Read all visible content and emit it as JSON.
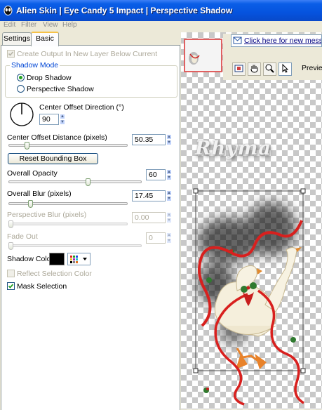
{
  "window": {
    "title": "Alien Skin | Eye Candy 5 Impact | Perspective Shadow"
  },
  "menu": [
    "Edit",
    "Filter",
    "View",
    "Help"
  ],
  "tabs": [
    {
      "label": "Settings",
      "active": false
    },
    {
      "label": "Basic",
      "active": true
    }
  ],
  "basic": {
    "create_output_label": "Create Output In New Layer Below Current",
    "create_output_checked": true,
    "shadow_mode": {
      "legend": "Shadow Mode",
      "options": [
        "Drop Shadow",
        "Perspective Shadow"
      ],
      "selected": "Drop Shadow"
    },
    "center_offset_direction": {
      "label": "Center Offset Direction (°)",
      "value": "90"
    },
    "center_offset_distance": {
      "label": "Center Offset Distance (pixels)",
      "value": "50.35",
      "level": 0.14
    },
    "reset_button": "Reset Bounding Box",
    "overall_opacity": {
      "label": "Overall Opacity",
      "value": "60",
      "level": 0.6
    },
    "overall_blur": {
      "label": "Overall Blur (pixels)",
      "value": "17.45",
      "level": 0.17
    },
    "perspective_blur": {
      "label": "Perspective Blur (pixels)",
      "value": "0.00",
      "level": 0.0
    },
    "fade_out": {
      "label": "Fade Out",
      "value": "0",
      "level": 0.0
    },
    "shadow_color_label": "Shadow Color",
    "shadow_color": "#000000",
    "reflect_selection_label": "Reflect Selection Color",
    "reflect_selection_checked": false,
    "mask_selection_label": "Mask Selection",
    "mask_selection_checked": true
  },
  "preview": {
    "link_text": "Click here for new messages",
    "preview_label": "Preview",
    "watermark_text": "Rhyma",
    "tools": [
      "navigator-icon",
      "hand-icon",
      "zoom-icon",
      "pointer-icon"
    ]
  }
}
